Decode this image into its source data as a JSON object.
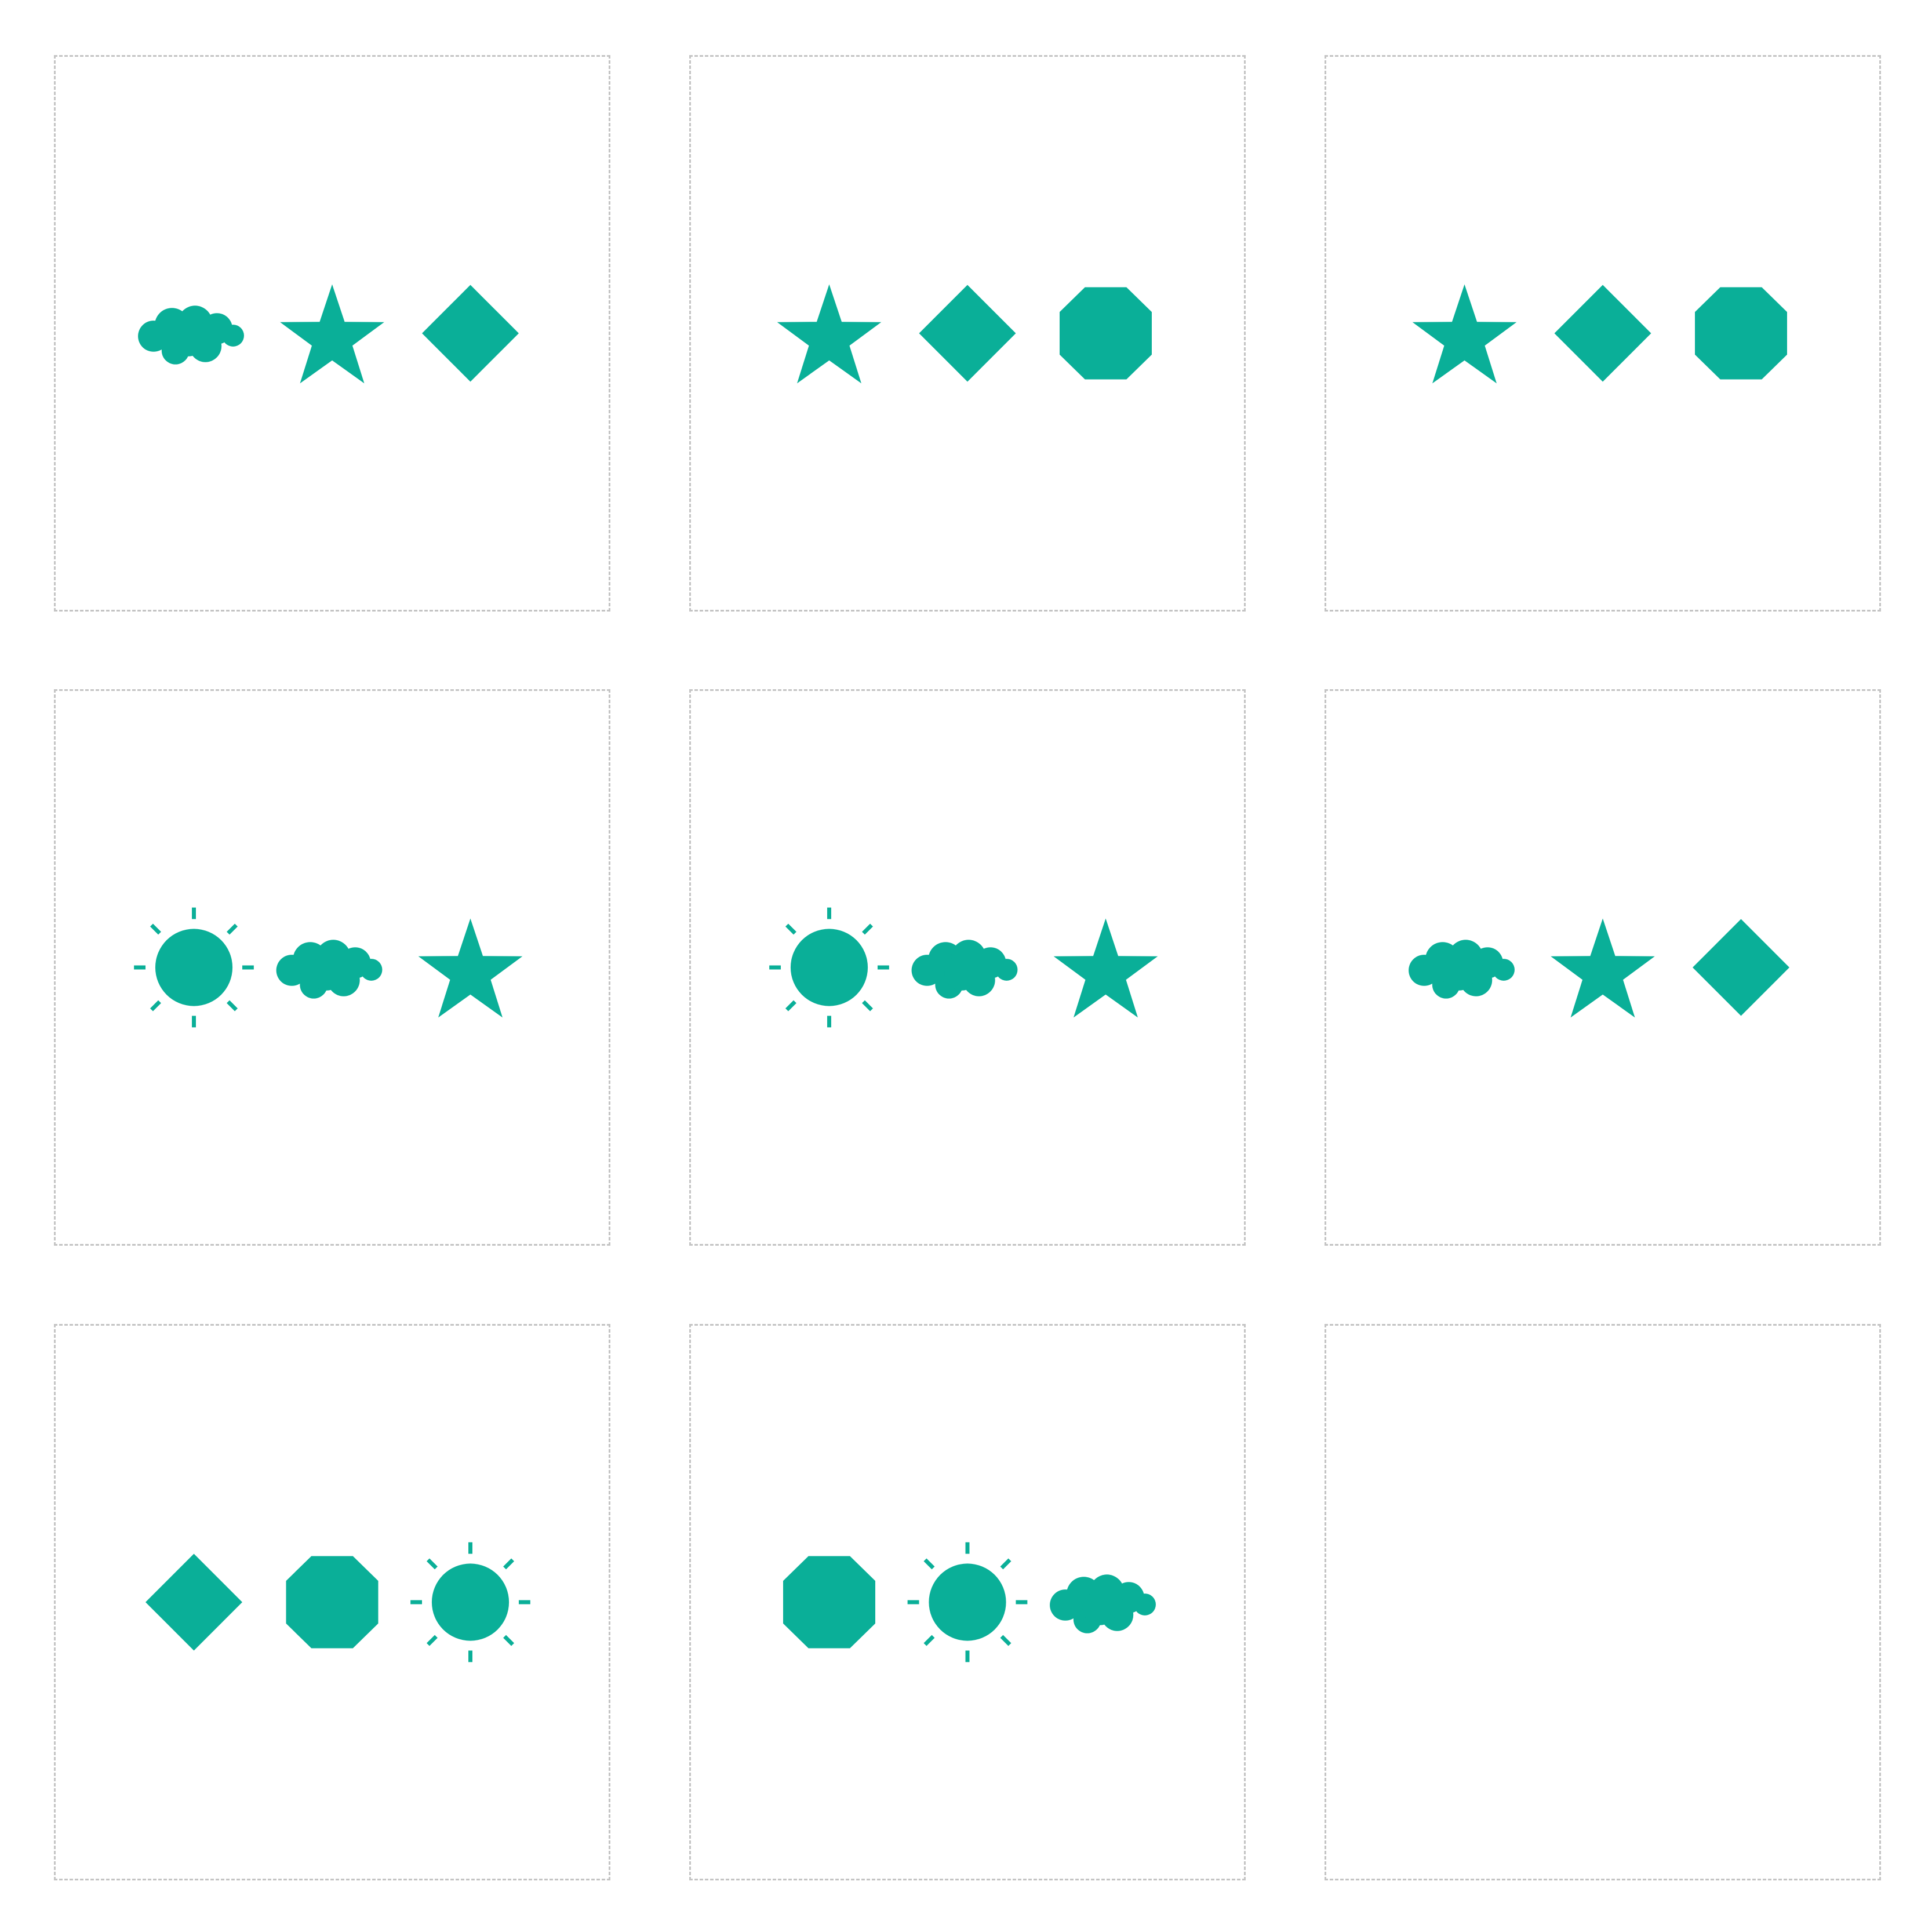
{
  "theme": {
    "shape_color": "#0aaf98",
    "border_color": "#c4c4c4",
    "background": "#ffffff"
  },
  "grid": {
    "rows": 3,
    "cols": 3,
    "cells": [
      {
        "shapes": [
          "cloud-icon",
          "star-icon",
          "diamond-icon"
        ]
      },
      {
        "shapes": [
          "star-icon",
          "diamond-icon",
          "octagon-icon"
        ]
      },
      {
        "shapes": [
          "star-icon",
          "diamond-icon",
          "octagon-icon"
        ]
      },
      {
        "shapes": [
          "sun-icon",
          "cloud-icon",
          "star-icon"
        ]
      },
      {
        "shapes": [
          "sun-icon",
          "cloud-icon",
          "star-icon"
        ]
      },
      {
        "shapes": [
          "cloud-icon",
          "star-icon",
          "diamond-icon"
        ]
      },
      {
        "shapes": [
          "diamond-icon",
          "octagon-icon",
          "sun-icon"
        ]
      },
      {
        "shapes": [
          "octagon-icon",
          "sun-icon",
          "cloud-icon"
        ]
      },
      {
        "shapes": []
      }
    ]
  }
}
